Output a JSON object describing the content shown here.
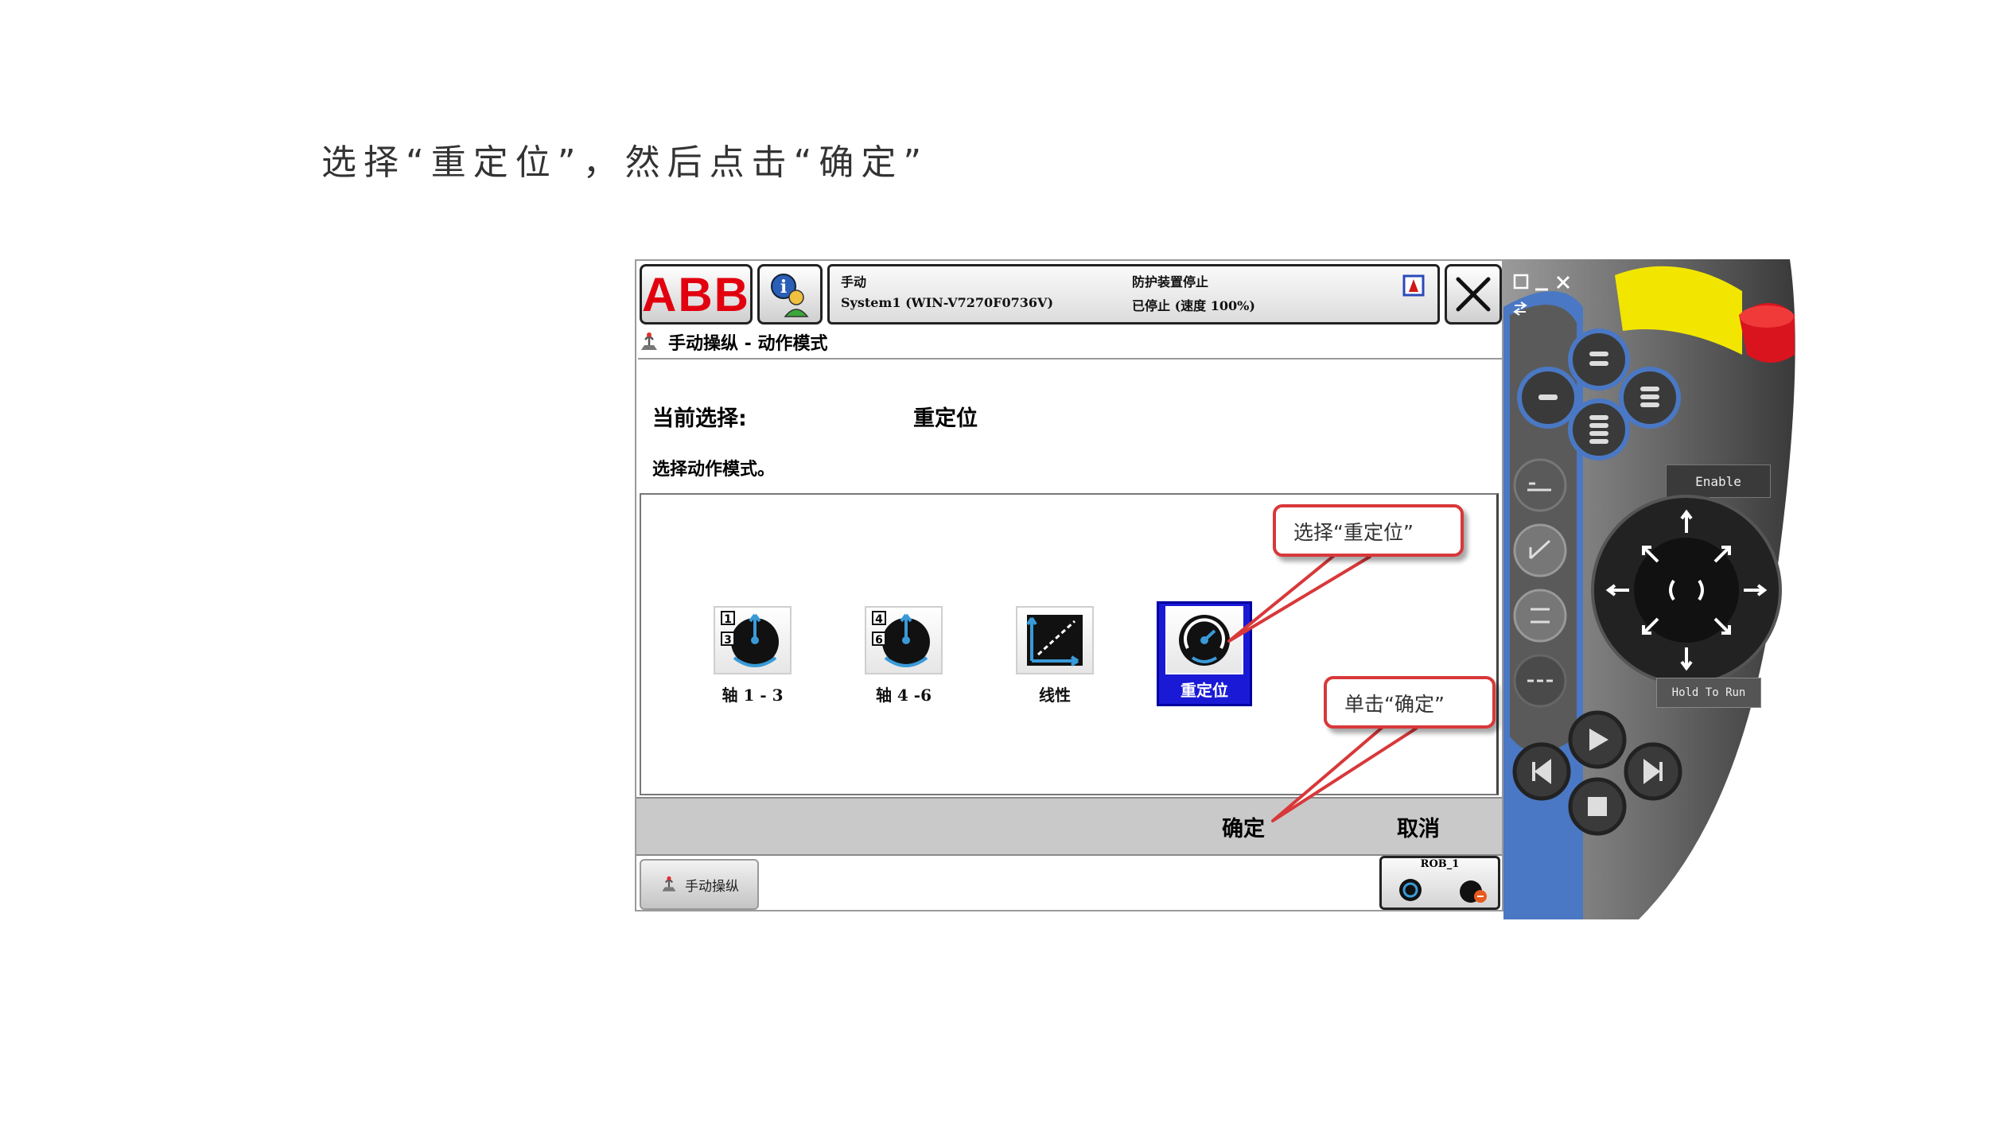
{
  "instruction": "选择“重定位”，然后点击“确定”",
  "header": {
    "logo": "ABB",
    "status": {
      "mode": "手动",
      "system": "System1 (WIN-V7270F0736V)",
      "guard": "防护装置停止",
      "speed": "已停止 (速度 100%)"
    }
  },
  "breadcrumb": "手动操纵 - 动作模式",
  "current": {
    "label": "当前选择:",
    "value": "重定位"
  },
  "prompt": "选择动作模式。",
  "modes": [
    {
      "label": "轴 1 - 3",
      "icon": "axis-1-3-icon"
    },
    {
      "label": "轴 4 -6",
      "icon": "axis-4-6-icon"
    },
    {
      "label": "线性",
      "icon": "linear-icon"
    },
    {
      "label": "重定位",
      "icon": "reorient-icon",
      "selected": true
    }
  ],
  "commands": {
    "ok": "确定",
    "cancel": "取消"
  },
  "taskbar": {
    "jog": "手动操纵",
    "robot": "ROB_1"
  },
  "callouts": {
    "select": "选择“重定位”",
    "click": "单击“确定”"
  },
  "pendant": {
    "enable": "Enable",
    "hold": "Hold To Run"
  },
  "colors": {
    "abb_red": "#e2000f",
    "selected_blue": "#1a1ad6",
    "callout_red": "#d8383a",
    "pendant_blue": "#4a78c4",
    "estop_red": "#d9141e",
    "guard_yellow": "#f2e600"
  }
}
